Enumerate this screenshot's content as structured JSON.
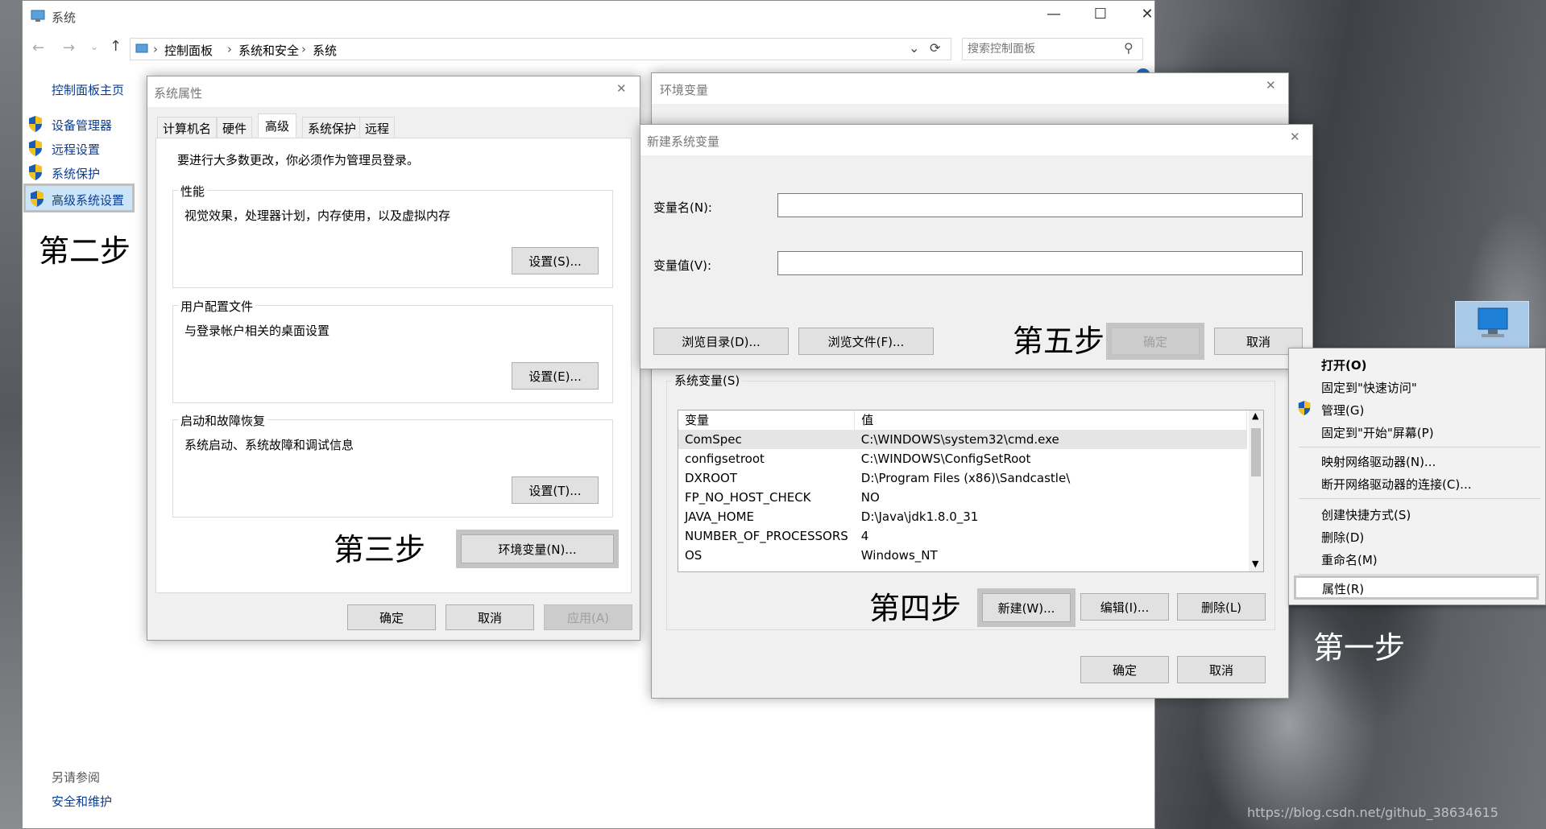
{
  "window": {
    "title": "系统",
    "minimize": "—",
    "maximize": "☐",
    "close": "✕"
  },
  "addressbar": {
    "crumbs": [
      "控制面板",
      "系统和安全",
      "系统"
    ],
    "search_placeholder": "搜索控制面板"
  },
  "sidebar": {
    "home": "控制面板主页",
    "items": [
      {
        "label": "设备管理器"
      },
      {
        "label": "远程设置"
      },
      {
        "label": "系统保护"
      },
      {
        "label": "高级系统设置"
      }
    ],
    "see_also": "另请参阅",
    "security": "安全和维护"
  },
  "steps": {
    "one": "第一步",
    "two": "第二步",
    "three": "第三步",
    "four": "第四步",
    "five": "第五步"
  },
  "sysprops": {
    "title": "系统属性",
    "tabs": [
      "计算机名",
      "硬件",
      "高级",
      "系统保护",
      "远程"
    ],
    "admin_note": "要进行大多数更改，你必须作为管理员登录。",
    "perf": {
      "label": "性能",
      "desc": "视觉效果，处理器计划，内存使用，以及虚拟内存",
      "btn": "设置(S)..."
    },
    "profile": {
      "label": "用户配置文件",
      "desc": "与登录帐户相关的桌面设置",
      "btn": "设置(E)..."
    },
    "startup": {
      "label": "启动和故障恢复",
      "desc": "系统启动、系统故障和调试信息",
      "btn": "设置(T)..."
    },
    "env_btn": "环境变量(N)...",
    "ok": "确定",
    "cancel": "取消",
    "apply": "应用(A)"
  },
  "envvars": {
    "title": "环境变量",
    "sys_label": "系统变量(S)",
    "col_var": "变量",
    "col_val": "值",
    "rows": [
      {
        "name": "ComSpec",
        "value": "C:\\WINDOWS\\system32\\cmd.exe"
      },
      {
        "name": "configsetroot",
        "value": "C:\\WINDOWS\\ConfigSetRoot"
      },
      {
        "name": "DXROOT",
        "value": "D:\\Program Files (x86)\\Sandcastle\\"
      },
      {
        "name": "FP_NO_HOST_CHECK",
        "value": "NO"
      },
      {
        "name": "JAVA_HOME",
        "value": "D:\\Java\\jdk1.8.0_31"
      },
      {
        "name": "NUMBER_OF_PROCESSORS",
        "value": "4"
      },
      {
        "name": "OS",
        "value": "Windows_NT"
      }
    ],
    "new": "新建(W)...",
    "edit": "编辑(I)...",
    "delete": "删除(L)",
    "ok": "确定",
    "cancel": "取消"
  },
  "newvar": {
    "title": "新建系统变量",
    "name_label": "变量名(N):",
    "value_label": "变量值(V):",
    "name_value": "",
    "value_value": "",
    "browse_dir": "浏览目录(D)...",
    "browse_file": "浏览文件(F)...",
    "ok": "确定",
    "cancel": "取消"
  },
  "context_menu": {
    "items": [
      "打开(O)",
      "固定到\"快速访问\"",
      "管理(G)",
      "固定到\"开始\"屏幕(P)",
      "映射网络驱动器(N)...",
      "断开网络驱动器的连接(C)...",
      "创建快捷方式(S)",
      "删除(D)",
      "重命名(M)",
      "属性(R)"
    ]
  },
  "watermark": "https://blog.csdn.net/github_38634615"
}
